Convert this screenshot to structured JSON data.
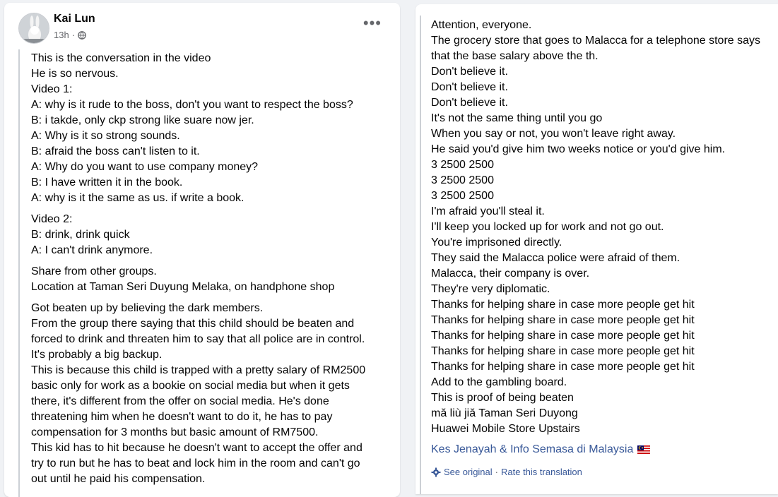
{
  "post": {
    "author": "Kai Lun",
    "time": "13h",
    "privacy_icon": "globe-icon",
    "menu_icon": "more-options-icon"
  },
  "left_paragraphs": [
    {
      "lines": [
        "This is the conversation in the video",
        "He is so nervous.",
        "Video 1:",
        "A: why is it rude to the boss, don't you want to respect the boss?",
        "B: i takde, only ckp strong like suare now jer.",
        "A: Why is it so strong sounds.",
        "B: afraid the boss can't listen to it.",
        "A: Why do you want to use company money?",
        "B: I have written it in the book.",
        "A: why is it the same as us. if write a book."
      ]
    },
    {
      "lines": [
        "Video 2:",
        "B: drink, drink quick",
        "A: I can't drink anymore."
      ]
    },
    {
      "lines": [
        "Share from other groups.",
        "Location at Taman Seri Duyung Melaka, on handphone shop"
      ]
    },
    {
      "lines": [
        "Got beaten up by believing the dark members.",
        "From the group there saying that this child should be beaten and",
        "forced to drink and threaten him to say that all police are in control.",
        "It's probably a big backup.",
        "This is because this child is trapped with a pretty salary of RM2500",
        "basic only for work as a bookie on social media but when it gets",
        "there, it's different from the offer on social media. He's done",
        "threatening him when he doesn't want to do it, he has to pay",
        "compensation for 3 months but basic amount of RM7500.",
        "This kid has to hit because he doesn't want to accept the offer and",
        "try to run but he has to beat and lock him in the room and can't go",
        "out until he paid his compensation."
      ]
    }
  ],
  "right_lines": [
    "Attention, everyone.",
    "The grocery store that goes to Malacca for a telephone store says",
    "that the base salary above the th.",
    "Don't believe it.",
    "Don't believe it.",
    "Don't believe it.",
    "It's not the same thing until you go",
    "When you say or not, you won't leave right away.",
    "He said you'd give him two weeks notice or you'd give him.",
    "3 2500 2500",
    "3 2500 2500",
    "3 2500 2500",
    "I'm afraid you'll steal it.",
    "I'll keep you locked up for work and not go out.",
    "You're imprisoned directly.",
    "They said the Malacca police were afraid of them.",
    "Malacca, their company is over.",
    "They're very diplomatic.",
    "Thanks for helping share in case more people get hit",
    "Thanks for helping share in case more people get hit",
    "Thanks for helping share in case more people get hit",
    "Thanks for helping share in case more people get hit",
    "Thanks for helping share in case more people get hit",
    "Add to the gambling board.",
    "This is proof of being beaten",
    "mă liù jiă Taman Seri Duyong",
    "Huawei Mobile Store Upstairs"
  ],
  "group": {
    "name": "Kes Jenayah & Info Semasa di Malaysia",
    "flag_icon": "malaysia-flag-icon"
  },
  "translation": {
    "see_original": "See original",
    "separator": "·",
    "rate": "Rate this translation",
    "icon": "settings-gear-icon"
  },
  "colors": {
    "link": "#385898",
    "meta": "#65676b",
    "text": "#050505",
    "background": "#f0f2f5"
  }
}
